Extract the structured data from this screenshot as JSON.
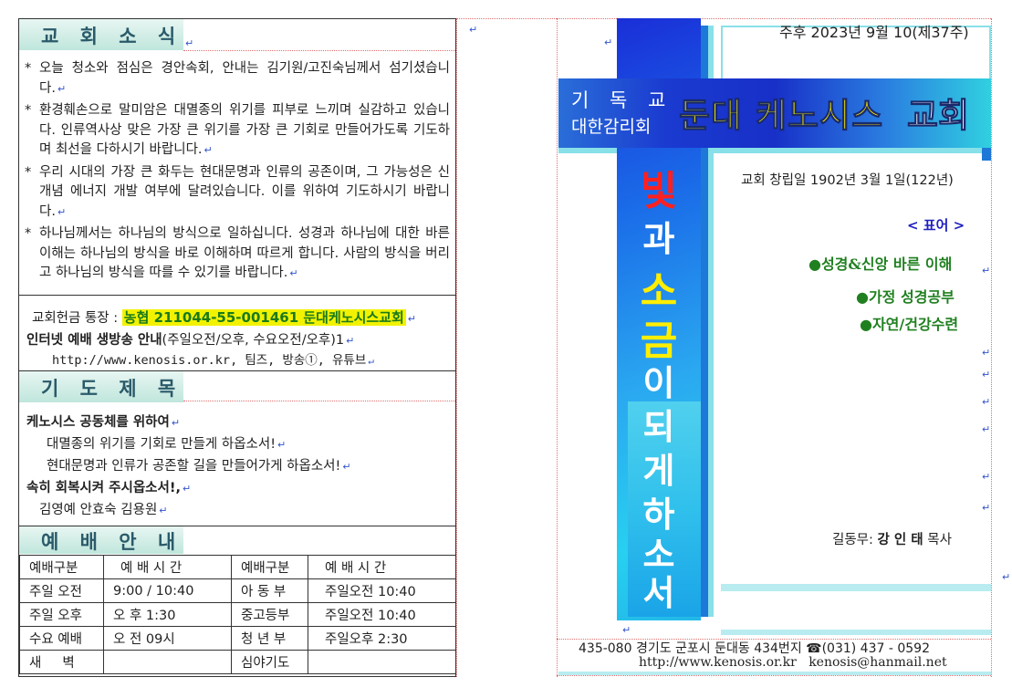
{
  "left": {
    "news": {
      "title": "교 회 소 식",
      "items": [
        "오늘 청소와 점심은 경안속회, 안내는 김기원/고진숙님께서 섬기셨습니다.",
        "환경훼손으로 말미암은 대멸종의 위기를 피부로 느끼며 실감하고 있습니다. 인류역사상 맞은 가장 큰 위기를 가장 큰 기회로 만들어가도록 기도하며 최선을 다하시기 바랍니다.",
        "우리 시대의 가장 큰 화두는 현대문명과 인류의 공존이며, 그 가능성은 신개념 에너지 개발 여부에 달려있습니다. 이를 위하여 기도하시기 바랍니다.",
        "하나님께서는 하나님의 방식으로 일하십니다. 성경과 하나님에 대한 바른 이해는 하나님의 방식을 바로 이해하며 따르게 합니다. 사람의 방식을 버리고 하나님의 방식을 따를 수 있기를 바랍니다."
      ]
    },
    "offering": {
      "label": "교회헌금 통장 :",
      "account": "농협 211044-55-001461 둔대케노시스교회"
    },
    "broadcast": {
      "title": "인터넷 예배 생방송 안내",
      "detail": "(주일오전/오후, 수요오전/오후)1",
      "urls": "http://www.kenosis.or.kr, 팀즈, 방송①, 유튜브"
    },
    "prayer": {
      "title": "기 도 제 목",
      "group1": "케노시스 공동체를 위하여",
      "line1": "대멸종의 위기를 기회로 만들게 하옵소서!",
      "line2": "현대문명과 인류가 공존할 길을 만들어가게 하옵소서!",
      "group2": "속히 회복시켜 주시옵소서!,",
      "names": "김영예 안효숙 김용원"
    },
    "worship": {
      "title": "예 배 안 내",
      "headers": [
        "예배구분",
        "예 배 시 간",
        "예배구분",
        "예 배  시 간"
      ],
      "rows": [
        [
          "주일 오전",
          "9:00 / 10:40",
          "아 동 부",
          "주일오전 10:40"
        ],
        [
          "주일 오후",
          "오 후 1:30",
          "중고등부",
          "주일오전 10:40"
        ],
        [
          "수요 예배",
          "오 전 09시",
          "청 년 부",
          "주일오후 2:30"
        ],
        [
          "새     벽",
          "",
          "심야기도",
          ""
        ]
      ]
    }
  },
  "right": {
    "date": "주후 2023년 9월 10(제37주)",
    "denomination_line1": "기 독 교",
    "denomination_line2": "대한감리회",
    "church_name": "둔대 케노시스",
    "church_word": "교회",
    "vertical_chars": [
      "빛",
      "과",
      "소",
      "금",
      "이",
      "되",
      "게",
      "하",
      "소",
      "서"
    ],
    "founded": "교회 창립일 1902년 3월 1일(122년)",
    "motto_title": "< 표어 >",
    "motto": [
      "●성경&신앙 바른 이해",
      "●가정 성경공부",
      "●자연/건강수련"
    ],
    "pastor_label": "길동무:",
    "pastor_name": "강 인 태",
    "pastor_title": "목사",
    "address": "435-080 경기도 군포시 둔대동 434번지 ☎(031) 437 - 0592",
    "web": "http://www.kenosis.or.kr",
    "email": "kenosis@hanmail.net"
  },
  "colors": {
    "yellow_highlight": "#f2f200",
    "heading_teal": "#2a5a6a",
    "motto_green": "#208020",
    "cross_blue": "#1a3ad0",
    "cross_cyan": "#30c8ec",
    "red_char": "#ff2020",
    "yellow_char": "#ffee00"
  }
}
